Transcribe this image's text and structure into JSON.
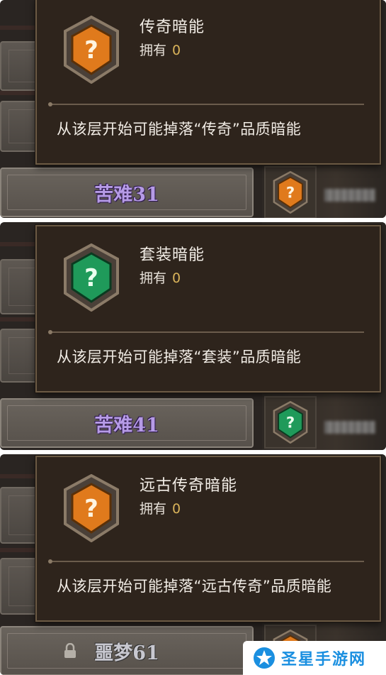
{
  "panels": [
    {
      "gem_color": "orange",
      "tooltip": {
        "title": "传奇暗能",
        "owned_label": "拥有",
        "owned_value": "0",
        "description": "从该层开始可能掉落“传奇”品质暗能"
      },
      "floor_label": "苦难31"
    },
    {
      "gem_color": "green",
      "tooltip": {
        "title": "套装暗能",
        "owned_label": "拥有",
        "owned_value": "0",
        "description": "从该层开始可能掉落“套装”品质暗能"
      },
      "floor_label": "苦难41"
    },
    {
      "gem_color": "orange",
      "tooltip": {
        "title": "远古传奇暗能",
        "owned_label": "拥有",
        "owned_value": "0",
        "description": "从该层开始可能掉落“远古传奇”品质暗能"
      },
      "floor_label": "噩梦61",
      "locked": true
    }
  ],
  "colors": {
    "orange_gem": "#e07a1c",
    "green_gem": "#1f9a5a",
    "floor_text": "#b69be6",
    "owned_value": "#d9b35a"
  },
  "watermark": {
    "text": "圣星手游网"
  }
}
